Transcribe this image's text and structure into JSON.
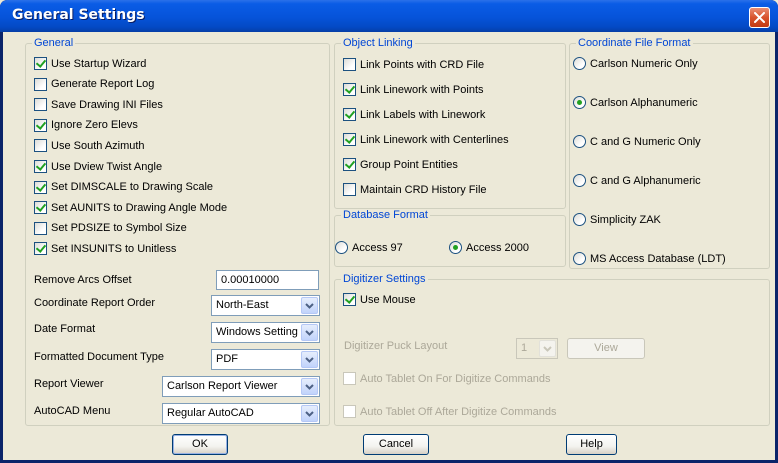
{
  "window": {
    "title": "General Settings"
  },
  "general": {
    "title": "General",
    "checkboxes": [
      {
        "label": "Use Startup Wizard",
        "checked": true
      },
      {
        "label": "Generate Report Log",
        "checked": false
      },
      {
        "label": "Save Drawing INI Files",
        "checked": false
      },
      {
        "label": "Ignore Zero Elevs",
        "checked": true
      },
      {
        "label": "Use South Azimuth",
        "checked": false
      },
      {
        "label": "Use Dview Twist Angle",
        "checked": true
      },
      {
        "label": "Set DIMSCALE to Drawing Scale",
        "checked": true
      },
      {
        "label": "Set AUNITS to Drawing Angle Mode",
        "checked": true
      },
      {
        "label": "Set PDSIZE to Symbol Size",
        "checked": false
      },
      {
        "label": "Set INSUNITS to Unitless",
        "checked": true
      }
    ],
    "remove_arcs_offset": {
      "label": "Remove Arcs Offset",
      "value": "0.00010000"
    },
    "coordinate_report_order": {
      "label": "Coordinate Report Order",
      "value": "North-East"
    },
    "date_format": {
      "label": "Date Format",
      "value": "Windows Setting"
    },
    "formatted_document_type": {
      "label": "Formatted Document Type",
      "value": "PDF"
    },
    "report_viewer": {
      "label": "Report Viewer",
      "value": "Carlson Report Viewer"
    },
    "autocad_menu": {
      "label": "AutoCAD Menu",
      "value": "Regular AutoCAD"
    }
  },
  "object_linking": {
    "title": "Object Linking",
    "checkboxes": [
      {
        "label": "Link Points with CRD File",
        "checked": false
      },
      {
        "label": "Link Linework with Points",
        "checked": true
      },
      {
        "label": "Link Labels with Linework",
        "checked": true
      },
      {
        "label": "Link Linework with Centerlines",
        "checked": true
      },
      {
        "label": "Group Point Entities",
        "checked": true
      },
      {
        "label": "Maintain CRD History File",
        "checked": false
      }
    ]
  },
  "database_format": {
    "title": "Database Format",
    "options": [
      {
        "label": "Access 97",
        "selected": false
      },
      {
        "label": "Access 2000",
        "selected": true
      }
    ]
  },
  "coordinate_file_format": {
    "title": "Coordinate File Format",
    "options": [
      {
        "label": "Carlson Numeric Only",
        "selected": false
      },
      {
        "label": "Carlson Alphanumeric",
        "selected": true
      },
      {
        "label": "C and G Numeric Only",
        "selected": false
      },
      {
        "label": "C and G Alphanumeric",
        "selected": false
      },
      {
        "label": "Simplicity ZAK",
        "selected": false
      },
      {
        "label": "MS Access Database (LDT)",
        "selected": false
      }
    ]
  },
  "digitizer": {
    "title": "Digitizer Settings",
    "use_mouse": {
      "label": "Use Mouse",
      "checked": true
    },
    "puck_layout": {
      "label": "Digitizer Puck Layout",
      "value": "1"
    },
    "view_button": "View",
    "auto_on": {
      "label": "Auto Tablet On For Digitize Commands",
      "checked": false
    },
    "auto_off": {
      "label": "Auto Tablet Off After Digitize Commands",
      "checked": false
    }
  },
  "buttons": {
    "ok": "OK",
    "cancel": "Cancel",
    "help": "Help"
  },
  "colors": {
    "title_bar": "#0653d9",
    "group_title": "#0046d5",
    "close_button": "#d8532d",
    "check_mark": "#21a121"
  },
  "icons": {
    "close": "close-icon",
    "dropdown": "chevron-down-icon"
  }
}
